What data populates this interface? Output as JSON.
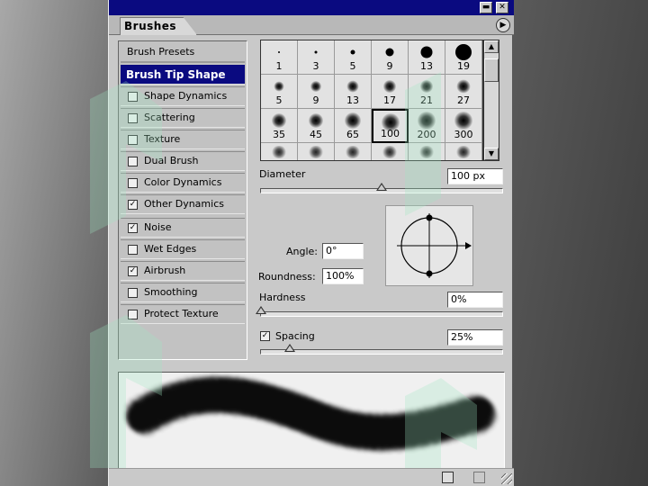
{
  "panel": {
    "title_buttons": {
      "minimize": "▬",
      "close": "✕"
    },
    "tab_label": "Brushes",
    "menu_icon": "▶"
  },
  "sidebar": {
    "presets_label": "Brush Presets",
    "items": [
      {
        "label": "Brush Tip Shape",
        "selected": true,
        "checkbox": false,
        "checked": false
      },
      {
        "label": "Shape Dynamics",
        "checkbox": true,
        "checked": false
      },
      {
        "label": "Scattering",
        "checkbox": true,
        "checked": false
      },
      {
        "label": "Texture",
        "checkbox": true,
        "checked": false
      },
      {
        "label": "Dual Brush",
        "checkbox": true,
        "checked": false
      },
      {
        "label": "Color Dynamics",
        "checkbox": true,
        "checked": false
      },
      {
        "label": "Other Dynamics",
        "checkbox": true,
        "checked": true
      },
      {
        "label": "Noise",
        "checkbox": true,
        "checked": true
      },
      {
        "label": "Wet Edges",
        "checkbox": true,
        "checked": false
      },
      {
        "label": "Airbrush",
        "checkbox": true,
        "checked": true
      },
      {
        "label": "Smoothing",
        "checkbox": true,
        "checked": false
      },
      {
        "label": "Protect Texture",
        "checkbox": true,
        "checked": false
      }
    ]
  },
  "brush_grid": {
    "sizes": [
      "1",
      "3",
      "5",
      "9",
      "13",
      "19",
      "5",
      "9",
      "13",
      "17",
      "21",
      "27",
      "35",
      "45",
      "65",
      "100",
      "200",
      "300"
    ],
    "hard_brushes": [
      true,
      true,
      true,
      true,
      true,
      true,
      false,
      false,
      false,
      false,
      false,
      false,
      false,
      false,
      false,
      false,
      false,
      false
    ],
    "selected": "100"
  },
  "controls": {
    "diameter_label": "Diameter",
    "diameter_value": "100 px",
    "diameter_slider": 0.5,
    "angle_label": "Angle:",
    "angle_value": "0°",
    "roundness_label": "Roundness:",
    "roundness_value": "100%",
    "hardness_label": "Hardness",
    "hardness_value": "0%",
    "hardness_slider": 0.0,
    "spacing_label": "Spacing",
    "spacing_value": "25%",
    "spacing_checked": true,
    "spacing_slider": 0.12
  },
  "colors": {
    "title_bar": "#0a0a80",
    "selected_row": "#0a0a80",
    "panel": "#c9c9c9",
    "watermark": "#9fe8c2"
  }
}
